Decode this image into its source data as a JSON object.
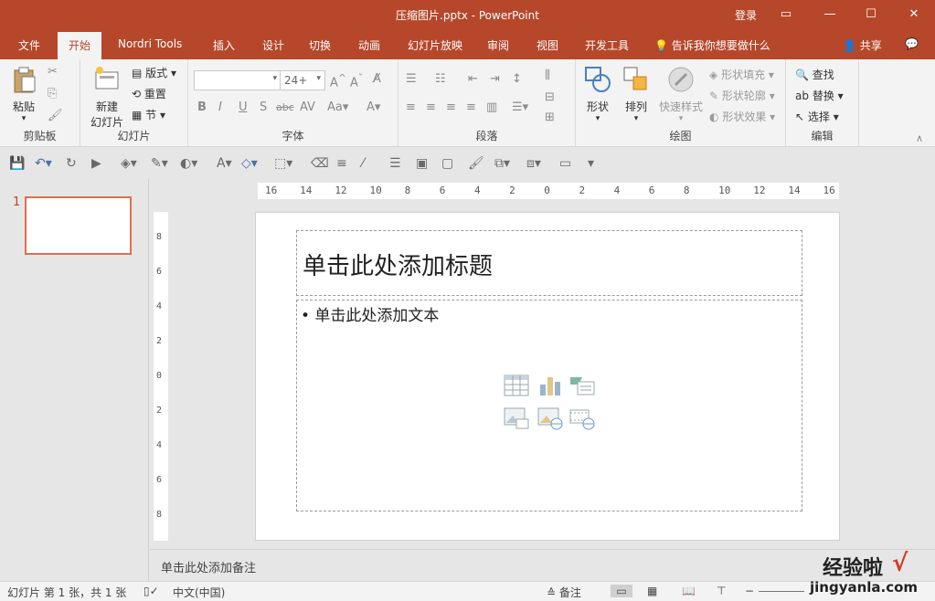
{
  "window": {
    "title": "压缩图片.pptx - PowerPoint",
    "login": "登录"
  },
  "tabs": [
    {
      "label": "文件"
    },
    {
      "label": "开始"
    },
    {
      "label": "Nordri Tools"
    },
    {
      "label": "插入"
    },
    {
      "label": "设计"
    },
    {
      "label": "切换"
    },
    {
      "label": "动画"
    },
    {
      "label": "幻灯片放映"
    },
    {
      "label": "审阅"
    },
    {
      "label": "视图"
    },
    {
      "label": "开发工具"
    },
    {
      "label": "告诉我你想要做什么"
    },
    {
      "label": "共享"
    }
  ],
  "ribbon": {
    "clipboard": {
      "paste": "粘贴",
      "group": "剪贴板"
    },
    "slides": {
      "new_slide_1": "新建",
      "new_slide_2": "幻灯片",
      "layout": "版式",
      "reset": "重置",
      "section": "节",
      "group": "幻灯片"
    },
    "font": {
      "size": "24+",
      "group": "字体"
    },
    "paragraph": {
      "group": "段落"
    },
    "drawing": {
      "shapes": "形状",
      "arrange": "排列",
      "quick_styles": "快速样式",
      "shape_fill": "形状填充",
      "shape_outline": "形状轮廓",
      "shape_effects": "形状效果",
      "group": "绘图"
    },
    "editing": {
      "find": "查找",
      "replace": "替换",
      "select": "选择",
      "group": "编辑"
    }
  },
  "slides_pane": {
    "current_number": "1"
  },
  "ruler": {
    "h_labels": [
      "16",
      "14",
      "12",
      "10",
      "8",
      "6",
      "4",
      "2",
      "0",
      "2",
      "4",
      "6",
      "8",
      "10",
      "12",
      "14",
      "16"
    ],
    "v_labels": [
      "8",
      "6",
      "4",
      "2",
      "0",
      "2",
      "4",
      "6",
      "8"
    ]
  },
  "slide": {
    "title_placeholder": "单击此处添加标题",
    "body_placeholder": "• 单击此处添加文本"
  },
  "notes": {
    "placeholder": "单击此处添加备注"
  },
  "status": {
    "slide_info": "幻灯片 第 1 张，共 1 张",
    "language": "中文(中国)",
    "notes_label": "备注"
  },
  "watermark": {
    "line1": "经验啦",
    "line2": "jingyanla.com"
  },
  "colors": {
    "accent": "#b7472a",
    "thumb_border": "#e26e4a"
  }
}
